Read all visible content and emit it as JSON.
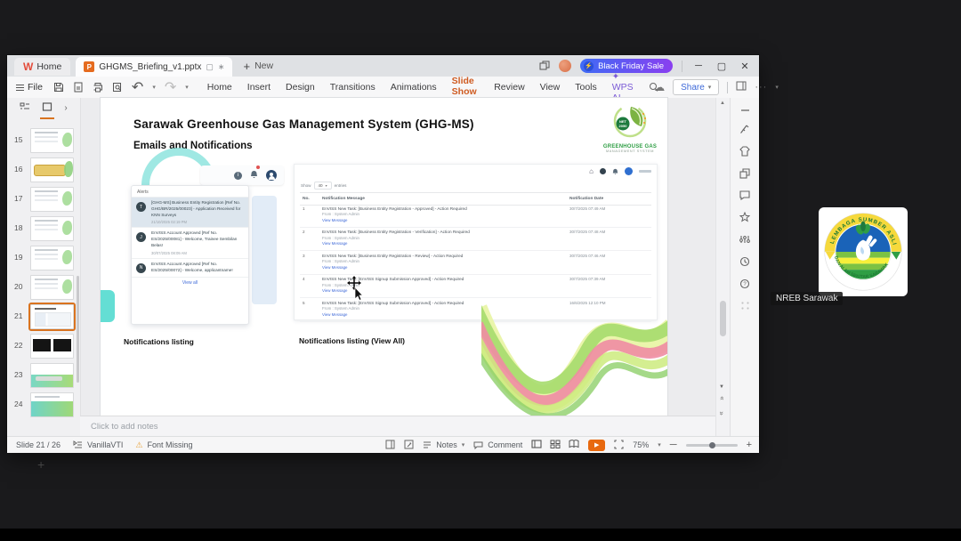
{
  "tab_bar": {
    "home_label": "Home",
    "document_title": "GHGMS_Briefing_v1.pptx",
    "new_label": "New",
    "promo_label": "Black Friday Sale"
  },
  "toolbar": {
    "file_label": "File",
    "menu_items": [
      "Home",
      "Insert",
      "Design",
      "Transitions",
      "Animations",
      "Slide Show",
      "Review",
      "View",
      "Tools",
      "WPS AI"
    ],
    "active_menu": "Slide Show",
    "share_label": "Share"
  },
  "thumbnail_panel": {
    "selected_slide": "21",
    "slides": [
      {
        "num": "15",
        "variant": "lines"
      },
      {
        "num": "16",
        "variant": "yellow"
      },
      {
        "num": "17",
        "variant": "lines"
      },
      {
        "num": "18",
        "variant": "lines"
      },
      {
        "num": "19",
        "variant": "lines"
      },
      {
        "num": "20",
        "variant": "lines"
      },
      {
        "num": "21",
        "variant": "current"
      },
      {
        "num": "22",
        "variant": "dark"
      },
      {
        "num": "23",
        "variant": "green"
      },
      {
        "num": "24",
        "variant": "green2"
      }
    ]
  },
  "slide": {
    "title": "Sarawak Greenhouse Gas Management System (GHG-MS)",
    "subtitle": "Emails and Notifications",
    "logo": {
      "badge_line1": "NET",
      "badge_line2": "2050",
      "name_line1": "GREENHOUSE GAS",
      "name_line2": "MANAGEMENT SYSTEM"
    },
    "alerts_panel": {
      "title": "Alerts",
      "items": [
        {
          "avatar": "T",
          "text": "[GHG-MS] Business Entity Registration [Ref No. GHG/BR/2025/00023] - Application Received for KNN Surveys",
          "time": "21/10/2025 02:19 PM"
        },
        {
          "avatar": "J",
          "text": "EnVISS Account Approved [Ref No. ES/2025/00081] - Welcome, Trainee Sembilan Belas!",
          "time": "30/07/2025 08:09 AM"
        },
        {
          "avatar": "N",
          "text": "EnVISS Account Approved [Ref No. ES/2025/00072] - Welcome, applicantname!",
          "time": ""
        }
      ],
      "view_all_label": "View all"
    },
    "notifications_table": {
      "show_prefix": "Show",
      "show_value": "40",
      "show_suffix": "entries",
      "columns": [
        "No.",
        "Notification Message",
        "Notification Date"
      ],
      "rows": [
        {
          "no": "1",
          "message": "EnVISS New Task: [Business Entity Registration - Approved] - Action Required",
          "from": "From : System Admin",
          "link": "View Message",
          "date": "30/7/2025 07:49 AM"
        },
        {
          "no": "2",
          "message": "EnVISS New Task: [Business Entity Registration - Verification] - Action Required",
          "from": "From : System Admin",
          "link": "View Message",
          "date": "30/7/2025 07:48 AM"
        },
        {
          "no": "3",
          "message": "EnVISS New Task: [Business Entity Registration - Review] - Action Required",
          "from": "From : System Admin",
          "link": "View Message",
          "date": "30/7/2025 07:46 AM"
        },
        {
          "no": "4",
          "message": "EnVISS New Task: [EnVISS Signup Submission Approved] - Action Required",
          "from": "From : System Admin",
          "link": "View Message",
          "date": "30/7/2025 07:39 AM"
        },
        {
          "no": "5",
          "message": "EnVISS New Task: [EnVISS Signup Submission Approved] - Action Required",
          "from": "From : System Admin",
          "link": "View Message",
          "date": "16/6/2025 12:10 PM"
        }
      ]
    },
    "captions": {
      "left": "Notifications listing",
      "right": "Notifications listing (View All)"
    }
  },
  "notes_bar": {
    "placeholder": "Click to add notes"
  },
  "status_bar": {
    "slide_counter": "Slide 21 / 26",
    "theme_name": "VanillaVTI",
    "font_warning": "Font Missing",
    "notes_label": "Notes",
    "comment_label": "Comment",
    "zoom_value": "75%"
  },
  "meeting": {
    "participant_label": "NREB Sarawak",
    "logo": {
      "arc_top": "LEMBAGA SUMBER ASLI",
      "arc_bottom": "DAN ALAM SEKITAR SARAWAK"
    }
  },
  "colors": {
    "accent_orange": "#cf5b21",
    "promo_gradient_start": "#3f6bf5",
    "promo_gradient_end": "#8a3ff0",
    "link_blue": "#3f6ad8",
    "play_button": "#e8690f"
  }
}
